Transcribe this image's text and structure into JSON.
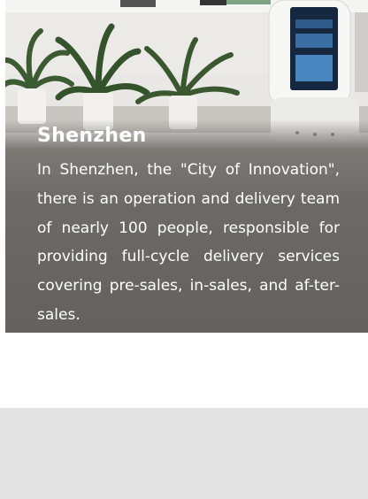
{
  "section": {
    "title": "Shenzhen",
    "description": "In Shenzhen, the \"City of Innovation\", there is an operation and delivery team of nearly 100 people, responsible for providing full-cycle delivery services covering pre-sales, in-sales, and af-ter-sales."
  },
  "image": {
    "icons": [
      "potted-plant-icon",
      "service-robot-icon"
    ]
  },
  "colors": {
    "overlay": "#66625f",
    "text": "#ffffff",
    "bottom_band": "#e4e4e4"
  }
}
